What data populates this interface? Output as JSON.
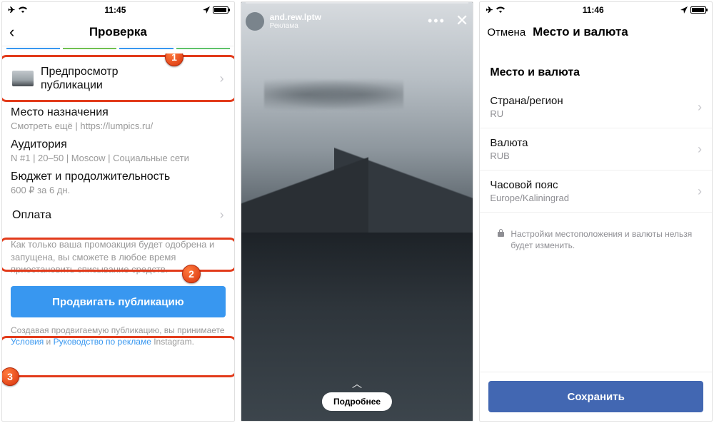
{
  "screen1": {
    "status": {
      "time": "11:45"
    },
    "header_title": "Проверка",
    "preview": {
      "line1": "Предпросмотр",
      "line2": "публикации"
    },
    "destination": {
      "label": "Место назначения",
      "value": "Смотреть ещё | https://lumpics.ru/"
    },
    "audience": {
      "label": "Аудитория",
      "value": "N #1 | 20–50 | Moscow | Социальные сети"
    },
    "budget": {
      "label": "Бюджет и продолжительность",
      "value": "600 ₽ за 6 дн."
    },
    "payment": {
      "label": "Оплата"
    },
    "hint": "Как только ваша промоакция будет одобрена и запущена, вы сможете в любое время приостановить списывание средств.",
    "promote_btn": "Продвигать публикацию",
    "terms_pre": "Создавая продвигаемую публикацию, вы принимаете ",
    "terms_link1": "Условия",
    "terms_mid": " и ",
    "terms_link2": "Руководство по рекламе",
    "terms_post": " Instagram.",
    "badges": {
      "b1": "1",
      "b2": "2",
      "b3": "3"
    }
  },
  "screen2": {
    "username": "and.rew.lptw",
    "ad_label": "Реклама",
    "cta": "Подробнее"
  },
  "screen3": {
    "status": {
      "time": "11:46"
    },
    "cancel": "Отмена",
    "title": "Место и валюта",
    "section": "Место и валюта",
    "country": {
      "label": "Страна/регион",
      "value": "RU"
    },
    "currency": {
      "label": "Валюта",
      "value": "RUB"
    },
    "timezone": {
      "label": "Часовой пояс",
      "value": "Europe/Kaliningrad"
    },
    "note": "Настройки местоположения и валюты нельзя будет изменить.",
    "save": "Сохранить"
  }
}
